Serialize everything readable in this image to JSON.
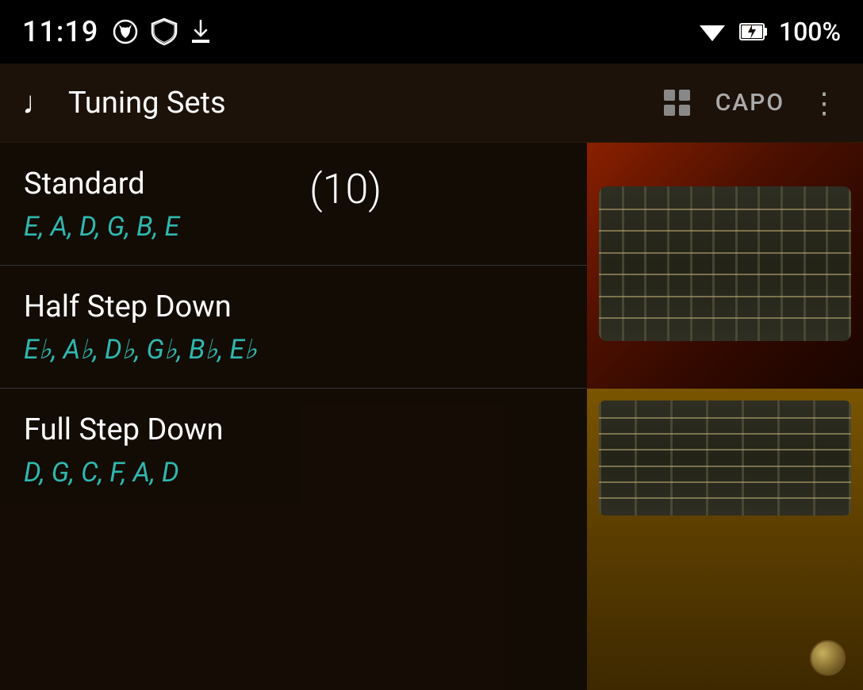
{
  "statusBar": {
    "time": "11:19",
    "battery": "100%",
    "icons": [
      "notification-cat-icon",
      "shield-icon",
      "download-icon"
    ]
  },
  "appBar": {
    "title": "Tuning Sets",
    "capoLabel": "CAPO",
    "gridIconLabel": "grid-view-icon",
    "moreIconLabel": "more-options-icon"
  },
  "tunings": [
    {
      "name": "Standard",
      "notes": "E, A, D, G, B, E",
      "count": "(10)"
    },
    {
      "name": "Half Step Down",
      "notes": "E♭, A♭, D♭, G♭, B♭, E♭",
      "count": ""
    },
    {
      "name": "Full Step Down",
      "notes": "D, G, C, F, A, D",
      "count": ""
    }
  ]
}
